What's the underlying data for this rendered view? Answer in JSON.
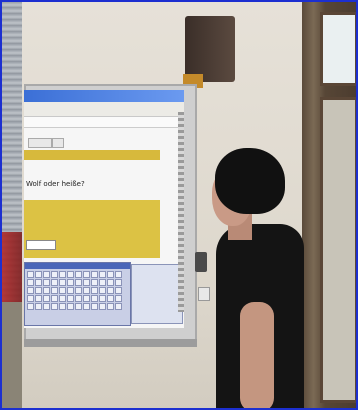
{
  "scene": {
    "colors": {
      "border": "#1c2fd0",
      "wall": "#e2ddd3",
      "board_yellow": "#dcc244",
      "titlebar_blue": "#3b6fd6",
      "shirt": "#141414"
    },
    "screen": {
      "tab_label": "",
      "band_text": "",
      "question": "Wolf oder heiße?",
      "sub_question": "",
      "block_text": "",
      "input_value": ""
    },
    "icons": [
      "speaker",
      "pen-holder",
      "power-outlet"
    ]
  }
}
